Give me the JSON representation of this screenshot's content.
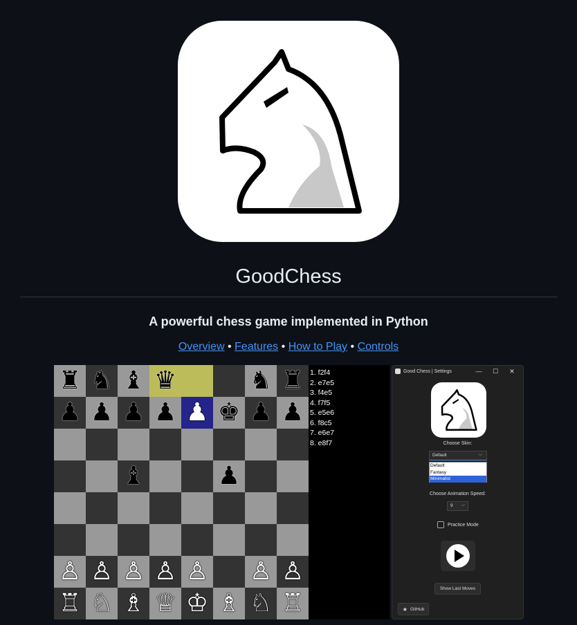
{
  "readme": {
    "title": "GoodChess",
    "subtitle": "A powerful chess game implemented in Python",
    "links": [
      "Overview",
      "Features",
      "How to Play",
      "Controls"
    ],
    "separator": "•"
  },
  "board": {
    "rows": [
      [
        {
          "p": "♜",
          "c": "b"
        },
        {
          "p": "♞",
          "c": "b"
        },
        {
          "p": "♝",
          "c": "b"
        },
        {
          "p": "♛",
          "c": "b",
          "hl": "yellow"
        },
        {
          "p": "",
          "c": "",
          "hl": "yellow"
        },
        {
          "p": "",
          "c": ""
        },
        {
          "p": "♞",
          "c": "b"
        },
        {
          "p": "♜",
          "c": "b"
        }
      ],
      [
        {
          "p": "♟",
          "c": "b"
        },
        {
          "p": "♟",
          "c": "b"
        },
        {
          "p": "♟",
          "c": "b"
        },
        {
          "p": "♟",
          "c": "b"
        },
        {
          "p": "♟",
          "c": "w",
          "hl": "blue"
        },
        {
          "p": "♚",
          "c": "b"
        },
        {
          "p": "♟",
          "c": "b"
        },
        {
          "p": "♟",
          "c": "b"
        }
      ],
      [
        {
          "p": "",
          "c": ""
        },
        {
          "p": "",
          "c": ""
        },
        {
          "p": "",
          "c": ""
        },
        {
          "p": "",
          "c": ""
        },
        {
          "p": "",
          "c": ""
        },
        {
          "p": "",
          "c": ""
        },
        {
          "p": "",
          "c": ""
        },
        {
          "p": "",
          "c": ""
        }
      ],
      [
        {
          "p": "",
          "c": ""
        },
        {
          "p": "",
          "c": ""
        },
        {
          "p": "♝",
          "c": "b"
        },
        {
          "p": "",
          "c": ""
        },
        {
          "p": "",
          "c": ""
        },
        {
          "p": "♟",
          "c": "b"
        },
        {
          "p": "",
          "c": ""
        },
        {
          "p": "",
          "c": ""
        }
      ],
      [
        {
          "p": "",
          "c": ""
        },
        {
          "p": "",
          "c": ""
        },
        {
          "p": "",
          "c": ""
        },
        {
          "p": "",
          "c": ""
        },
        {
          "p": "",
          "c": ""
        },
        {
          "p": "",
          "c": ""
        },
        {
          "p": "",
          "c": ""
        },
        {
          "p": "",
          "c": ""
        }
      ],
      [
        {
          "p": "",
          "c": ""
        },
        {
          "p": "",
          "c": ""
        },
        {
          "p": "",
          "c": ""
        },
        {
          "p": "",
          "c": ""
        },
        {
          "p": "",
          "c": ""
        },
        {
          "p": "",
          "c": ""
        },
        {
          "p": "",
          "c": ""
        },
        {
          "p": "",
          "c": ""
        }
      ],
      [
        {
          "p": "♙",
          "c": "w"
        },
        {
          "p": "♙",
          "c": "w"
        },
        {
          "p": "♙",
          "c": "w"
        },
        {
          "p": "♙",
          "c": "w"
        },
        {
          "p": "♙",
          "c": "w"
        },
        {
          "p": "",
          "c": ""
        },
        {
          "p": "♙",
          "c": "w"
        },
        {
          "p": "♙",
          "c": "w"
        }
      ],
      [
        {
          "p": "♖",
          "c": "w"
        },
        {
          "p": "♘",
          "c": "w"
        },
        {
          "p": "♗",
          "c": "w"
        },
        {
          "p": "♕",
          "c": "w"
        },
        {
          "p": "♔",
          "c": "w"
        },
        {
          "p": "♗",
          "c": "w"
        },
        {
          "p": "♘",
          "c": "w"
        },
        {
          "p": "♖",
          "c": "w"
        }
      ]
    ]
  },
  "moves": [
    "1. f2f4",
    "2. e7e5",
    "3. f4e5",
    "4. f7f5",
    "5. e5e6",
    "6. f8c5",
    "7. e6e7",
    "8. e8f7"
  ],
  "settings": {
    "window_title": "Good Chess | Settings",
    "minimize": "—",
    "maximize": "☐",
    "close": "✕",
    "choose_skin_label": "Choose Skin:",
    "skin_selected": "Default",
    "skin_options": [
      "Default",
      "Fantasy",
      "Minimalist"
    ],
    "skin_highlighted": "Minimalist",
    "choose_speed_label": "Choose Animation Speed:",
    "speed_value": "9",
    "practice_mode_label": "Practice Mode",
    "practice_mode_checked": false,
    "show_last_moves_label": "Show Last Moves",
    "github_label": "GitHub"
  },
  "colors": {
    "page_bg": "#0d1117",
    "link": "#4493f8",
    "light_square": "#999999",
    "dark_square": "#333333",
    "highlight_yellow": "#bcbc5a",
    "highlight_blue": "#24248a"
  }
}
